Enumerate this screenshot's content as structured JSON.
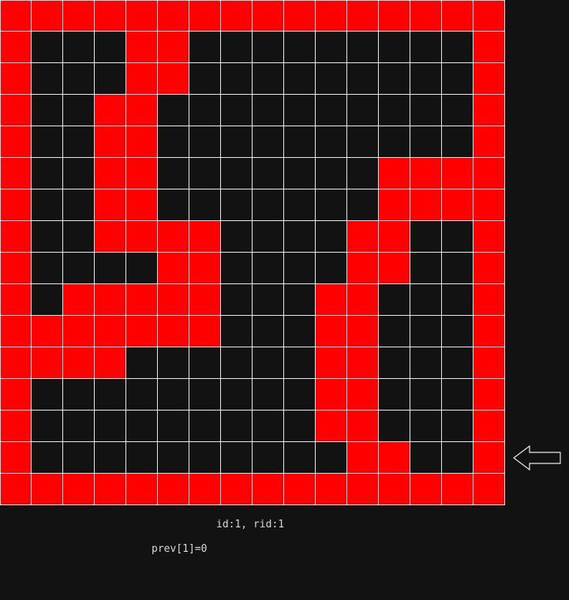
{
  "board": {
    "rows": 16,
    "cols": 16,
    "colors": {
      "wall": "#ff0000",
      "open": "#121212",
      "gridline": "#e8e8e8"
    },
    "cells": [
      "1111111111111111",
      "1000110000000001",
      "1000110000000001",
      "1001100000000001",
      "1001100000000001",
      "1001100000001111",
      "1001100000001111",
      "1001111000011001",
      "1000011000011001",
      "1011111000110001",
      "1111111000110001",
      "1111000000110001",
      "1000000000110001",
      "1000000000110001",
      "1000000000011001",
      "1111111111111111"
    ],
    "pointer": {
      "icon": "left-arrow-icon",
      "row": 14
    }
  },
  "status": {
    "id_text": "id:1, rid:1",
    "prev_text": "prev[1]=0"
  }
}
